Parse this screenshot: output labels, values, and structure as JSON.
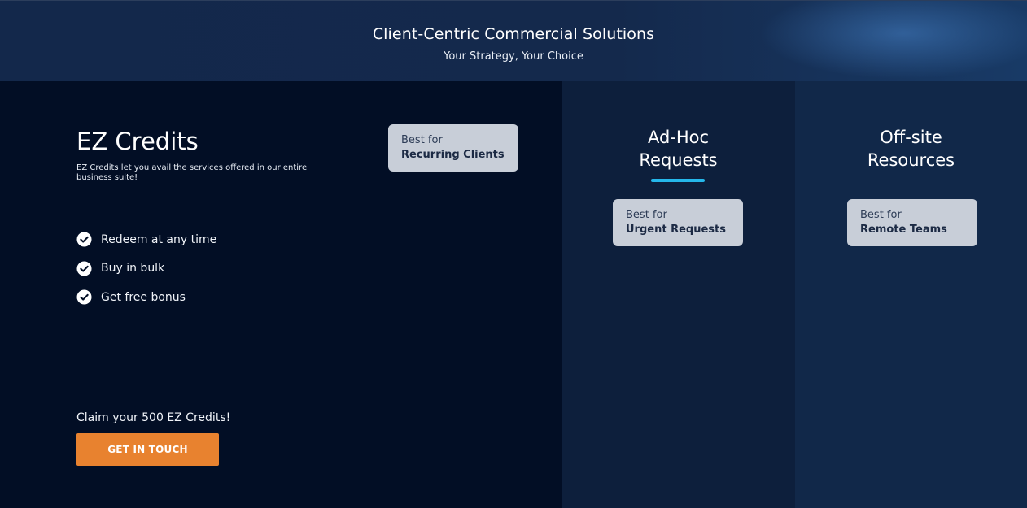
{
  "header": {
    "title": "Client-Centric Commercial Solutions",
    "subtitle": "Your Strategy, Your Choice"
  },
  "ez_credits": {
    "title": "EZ Credits",
    "description": "EZ Credits let you avail the services offered in our entire business suite!",
    "badge": {
      "top": "Best for",
      "bottom": "Recurring Clients"
    },
    "features": [
      {
        "label": "Redeem at any time",
        "icon": "check-circle-icon"
      },
      {
        "label": "Buy in bulk",
        "icon": "check-circle-icon"
      },
      {
        "label": "Get free bonus",
        "icon": "check-circle-icon"
      }
    ],
    "claim_text": "Claim your 500 EZ Credits!",
    "cta_label": "GET IN TOUCH"
  },
  "columns": [
    {
      "title_line1": "Ad-Hoc",
      "title_line2": "Requests",
      "active": true,
      "badge": {
        "top": "Best for",
        "bottom": "Urgent Requests"
      }
    },
    {
      "title_line1": "Off-site",
      "title_line2": "Resources",
      "active": false,
      "badge": {
        "top": "Best for",
        "bottom": "Remote Teams"
      }
    }
  ],
  "colors": {
    "accent_cta": "#e8822f",
    "accent_underline": "#25b7ea",
    "panel_main": "#020e25",
    "panel_adhoc": "#0d1f3c",
    "panel_offsite": "#112849",
    "badge_bg": "#c8ced8"
  }
}
